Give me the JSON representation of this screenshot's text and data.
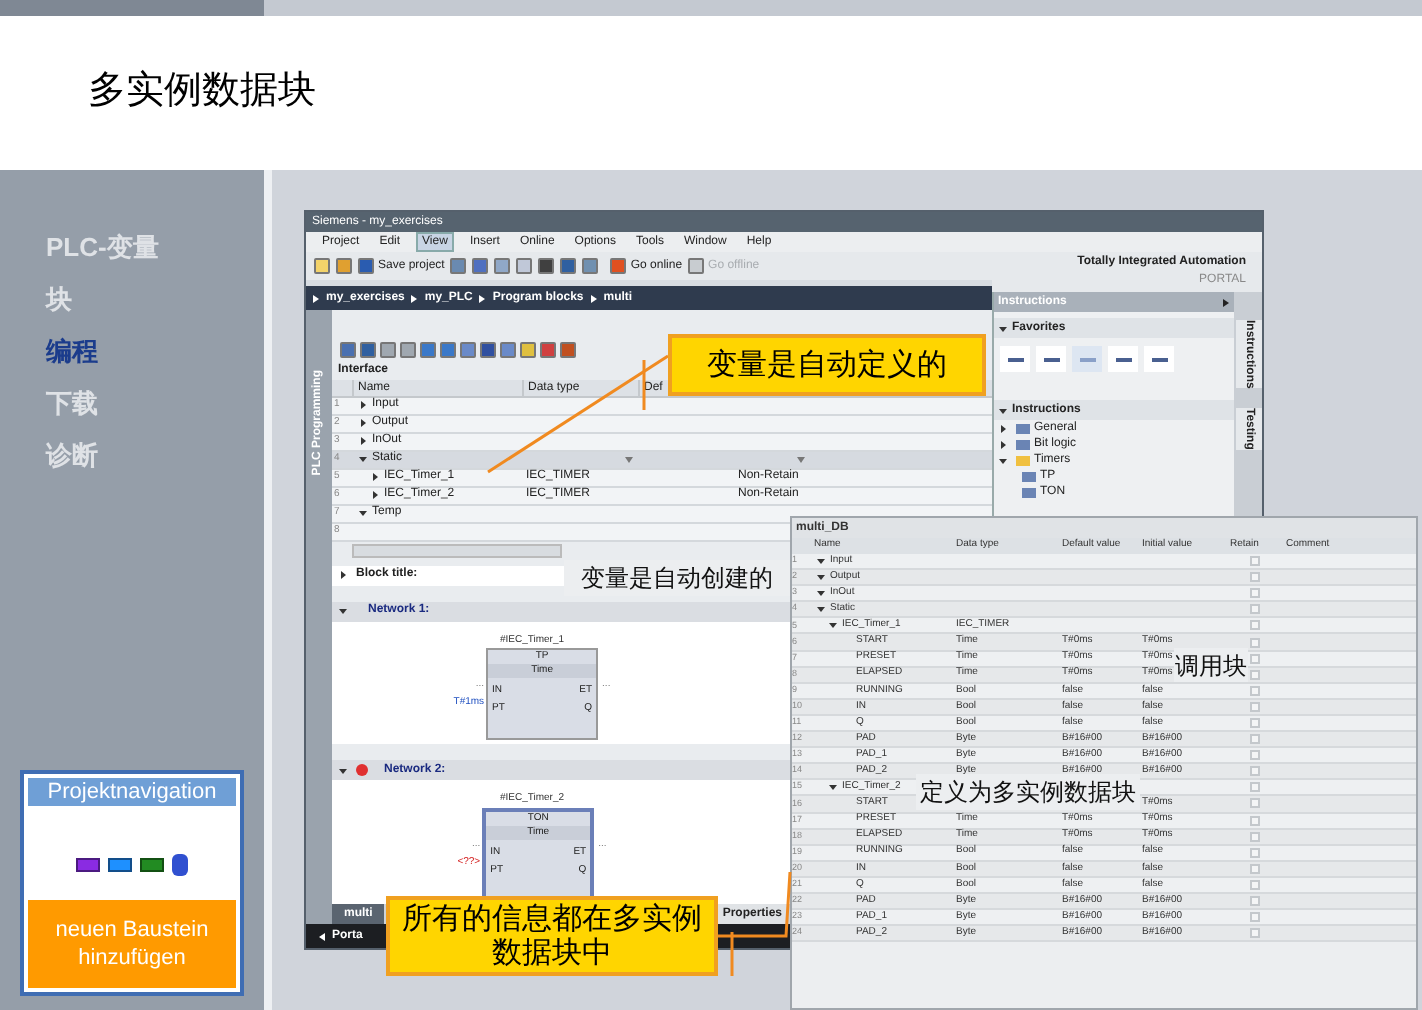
{
  "title": "多实例数据块",
  "nav": [
    {
      "label": "PLC-变量",
      "selected": false
    },
    {
      "label": "块",
      "selected": false
    },
    {
      "label": "编程",
      "selected": true
    },
    {
      "label": "下载",
      "selected": false
    },
    {
      "label": "诊断",
      "selected": false
    }
  ],
  "project_nav": {
    "title": "Projektnavigation",
    "button": "neuen Baustein hinzufügen"
  },
  "app": {
    "title": "Siemens - my_exercises",
    "menu": [
      {
        "label": "Project",
        "selected": false
      },
      {
        "label": "Edit",
        "selected": false
      },
      {
        "label": "View",
        "selected": true
      },
      {
        "label": "Insert",
        "selected": false
      },
      {
        "label": "Online",
        "selected": false
      },
      {
        "label": "Options",
        "selected": false
      },
      {
        "label": "Tools",
        "selected": false
      },
      {
        "label": "Window",
        "selected": false
      },
      {
        "label": "Help",
        "selected": false
      }
    ],
    "toolbar": {
      "save": "Save project",
      "go_online": "Go online",
      "go_offline": "Go offline",
      "go_offline_disabled": true
    },
    "brand": {
      "line1": "Totally Integrated Automation",
      "line2": "PORTAL"
    },
    "breadcrumb": [
      "my_exercises",
      "my_PLC",
      "Program blocks",
      "multi"
    ],
    "side_tab": "PLC Programming",
    "interface": {
      "title": "Interface",
      "columns": [
        "Name",
        "Data type",
        "Def"
      ],
      "rows": [
        {
          "num": "1",
          "name": "Input",
          "expanded": false,
          "selected": false
        },
        {
          "num": "2",
          "name": "Output",
          "expanded": false,
          "selected": false
        },
        {
          "num": "3",
          "name": "InOut",
          "expanded": false,
          "selected": false
        },
        {
          "num": "4",
          "name": "Static",
          "expanded": true,
          "selected": true,
          "children": [
            {
              "num": "5",
              "name": "IEC_Timer_1",
              "expanded": false,
              "selected": false,
              "type": "IEC_TIMER",
              "retain": "Non-Retain"
            },
            {
              "num": "6",
              "name": "IEC_Timer_2",
              "expanded": false,
              "selected": false,
              "type": "IEC_TIMER",
              "retain": "Non-Retain"
            }
          ]
        },
        {
          "num": "7",
          "name": "Temp",
          "expanded": true,
          "selected": false
        },
        {
          "num": "8",
          "selected": false
        }
      ]
    },
    "block_title": "Block title:",
    "networks": [
      {
        "title": "Network 1:",
        "error": false,
        "instance": "#IEC_Timer_1",
        "type": "TP",
        "subtype": "Time",
        "inputs": [
          "IN",
          "PT"
        ],
        "outputs": [
          "ET",
          "Q"
        ],
        "in_open": "...",
        "out_open": "...",
        "pt_value": "T#1ms",
        "pt_invalid": false
      },
      {
        "title": "Network 2:",
        "error": true,
        "instance": "#IEC_Timer_2",
        "type": "TON",
        "subtype": "Time",
        "inputs": [
          "IN",
          "PT"
        ],
        "outputs": [
          "ET",
          "Q"
        ],
        "in_open": "...",
        "out_open": "...",
        "pt_value": "<??>",
        "pt_invalid": true
      }
    ],
    "editor_tab": "multi",
    "properties_tab": "Properties",
    "portal_view": "Porta",
    "instructions": {
      "title": "Instructions",
      "favorites": "Favorites",
      "section": "Instructions",
      "tree": [
        {
          "label": "General",
          "expanded": false
        },
        {
          "label": "Bit logic",
          "expanded": false
        },
        {
          "label": "Timers",
          "expanded": true,
          "children": [
            {
              "label": "TP"
            },
            {
              "label": "TON"
            }
          ]
        }
      ]
    },
    "side_tabs": [
      "Instructions",
      "Testing"
    ]
  },
  "db": {
    "title": "multi_DB",
    "columns": [
      "Name",
      "Data type",
      "Default value",
      "Initial value",
      "Retain",
      "Comment"
    ],
    "rows": [
      {
        "num": "1",
        "name": "Input",
        "expanded": true,
        "retain": false
      },
      {
        "num": "2",
        "name": "Output",
        "expanded": true,
        "retain": false
      },
      {
        "num": "3",
        "name": "InOut",
        "expanded": true,
        "retain": false
      },
      {
        "num": "4",
        "name": "Static",
        "expanded": true,
        "retain": false,
        "children": [
          {
            "num": "5",
            "name": "IEC_Timer_1",
            "expanded": true,
            "type": "IEC_TIMER",
            "retain": false,
            "children": [
              {
                "num": "6",
                "name": "START",
                "type": "Time",
                "default": "T#0ms",
                "initial": "T#0ms",
                "retain": false
              },
              {
                "num": "7",
                "name": "PRESET",
                "type": "Time",
                "default": "T#0ms",
                "initial": "T#0ms",
                "retain": false
              },
              {
                "num": "8",
                "name": "ELAPSED",
                "type": "Time",
                "default": "T#0ms",
                "initial": "T#0ms",
                "retain": false
              },
              {
                "num": "9",
                "name": "RUNNING",
                "type": "Bool",
                "default": "false",
                "initial": "false",
                "retain": false
              },
              {
                "num": "10",
                "name": "IN",
                "type": "Bool",
                "default": "false",
                "initial": "false",
                "retain": false
              },
              {
                "num": "11",
                "name": "Q",
                "type": "Bool",
                "default": "false",
                "initial": "false",
                "retain": false
              },
              {
                "num": "12",
                "name": "PAD",
                "type": "Byte",
                "default": "B#16#00",
                "initial": "B#16#00",
                "retain": false
              },
              {
                "num": "13",
                "name": "PAD_1",
                "type": "Byte",
                "default": "B#16#00",
                "initial": "B#16#00",
                "retain": false
              },
              {
                "num": "14",
                "name": "PAD_2",
                "type": "Byte",
                "default": "B#16#00",
                "initial": "B#16#00",
                "retain": false
              }
            ]
          },
          {
            "num": "15",
            "name": "IEC_Timer_2",
            "expanded": true,
            "retain": false,
            "children": [
              {
                "num": "16",
                "name": "START",
                "initial": "T#0ms",
                "retain": false
              },
              {
                "num": "17",
                "name": "PRESET",
                "type": "Time",
                "default": "T#0ms",
                "initial": "T#0ms",
                "retain": false
              },
              {
                "num": "18",
                "name": "ELAPSED",
                "type": "Time",
                "default": "T#0ms",
                "initial": "T#0ms",
                "retain": false
              },
              {
                "num": "19",
                "name": "RUNNING",
                "type": "Bool",
                "default": "false",
                "initial": "false",
                "retain": false
              },
              {
                "num": "20",
                "name": "IN",
                "type": "Bool",
                "default": "false",
                "initial": "false",
                "retain": false
              },
              {
                "num": "21",
                "name": "Q",
                "type": "Bool",
                "default": "false",
                "initial": "false",
                "retain": false
              },
              {
                "num": "22",
                "name": "PAD",
                "type": "Byte",
                "default": "B#16#00",
                "initial": "B#16#00",
                "retain": false
              },
              {
                "num": "23",
                "name": "PAD_1",
                "type": "Byte",
                "default": "B#16#00",
                "initial": "B#16#00",
                "retain": false
              },
              {
                "num": "24",
                "name": "PAD_2",
                "type": "Byte",
                "default": "B#16#00",
                "initial": "B#16#00",
                "retain": false
              }
            ]
          }
        ]
      }
    ]
  },
  "callouts": [
    {
      "kind": "box",
      "text": "变量是自动定义的"
    },
    {
      "kind": "plain",
      "text": "变量是自动创建的"
    },
    {
      "kind": "plain",
      "text": "调用块"
    },
    {
      "kind": "plain",
      "text": "定义为多实例数据块"
    },
    {
      "kind": "box",
      "text": "所有的信息都在多实例数据块中"
    }
  ]
}
